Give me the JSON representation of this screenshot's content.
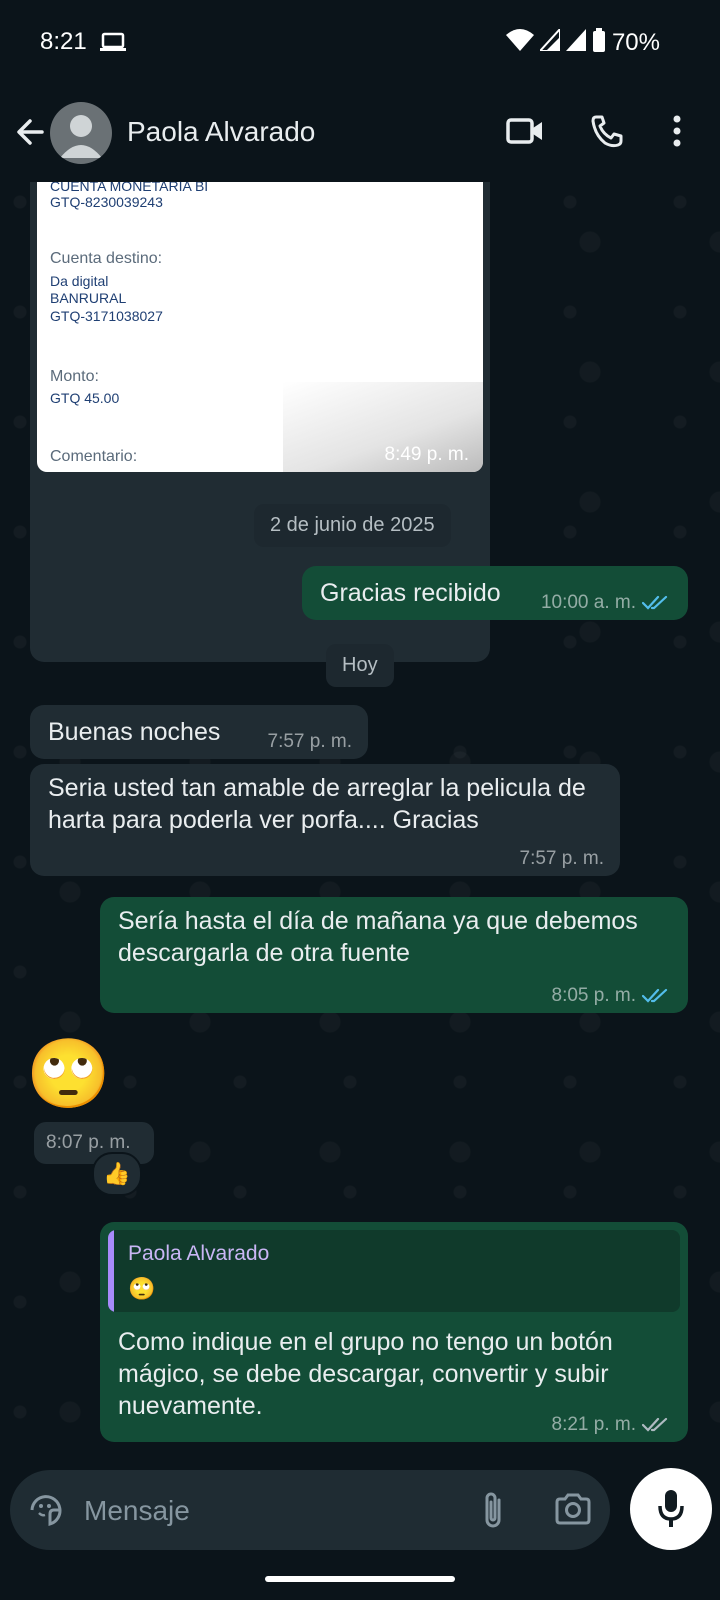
{
  "status_bar": {
    "time": "8:21",
    "battery": "70%"
  },
  "header": {
    "contact_name": "Paola Alvarado"
  },
  "receipt": {
    "cuenta_origen_label": "CUENTA MONETARIA BI",
    "cuenta_origen_number": "GTQ-8230039243",
    "destino_label": "Cuenta destino:",
    "destino_name": "Da digital",
    "destino_bank": "BANRURAL",
    "destino_number": "GTQ-3171038027",
    "monto_label": "Monto:",
    "monto_value": "GTQ 45.00",
    "comentario_label": "Comentario:",
    "time": "8:49 p. m."
  },
  "messages": {
    "date_chip_1": "2 de junio de 2025",
    "m1_text": "Gracias recibido",
    "m1_time": "10:00 a. m.",
    "date_chip_2": "Hoy",
    "m2_text": "Buenas noches",
    "m2_time": "7:57 p. m.",
    "m3_text": "Seria usted tan amable de arreglar la pelicula de harta para poderla ver porfa.... Gracias",
    "m3_time": "7:57 p. m.",
    "m4_text": "Sería hasta el día de mañana ya que debemos descargarla de otra fuente",
    "m4_time": "8:05 p. m.",
    "m5_emoji": "🙄",
    "m5_time": "8:07 p. m.",
    "m5_reaction": "👍",
    "m6_quote_name": "Paola Alvarado",
    "m6_quote_emoji": "🙄",
    "m6_text": "Como indique en el grupo no tengo un botón mágico, se debe descargar, convertir y subir nuevamente.",
    "m6_time": "8:21 p. m."
  },
  "composer": {
    "placeholder": "Mensaje"
  },
  "colors": {
    "background": "#0b141a",
    "incoming": "#202c33",
    "outgoing": "#134d37",
    "read_ticks": "#53bdeb"
  }
}
